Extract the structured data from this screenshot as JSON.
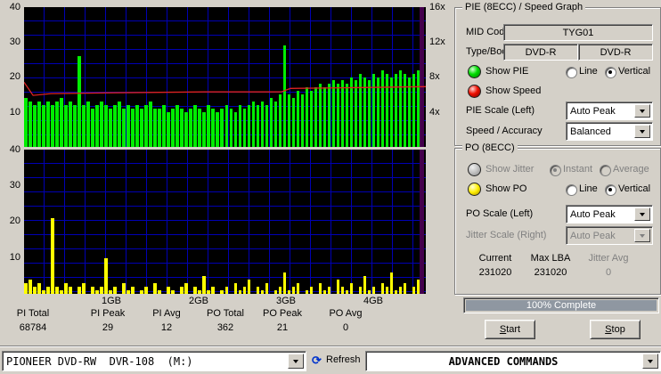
{
  "graphs": {
    "x_ticks": [
      "1GB",
      "2GB",
      "3GB",
      "4GB"
    ],
    "pie": {
      "y_ticks": [
        "40",
        "30",
        "20",
        "10"
      ],
      "speed_ticks": [
        "16x",
        "12x",
        "8x",
        "4x"
      ],
      "bar_color": "#00ee00",
      "ymax": 40,
      "end_marker_color": "#44004c",
      "values": [
        14,
        13,
        12,
        13,
        12,
        13,
        12,
        13,
        14,
        12,
        13,
        12,
        26,
        12,
        13,
        11,
        12,
        13,
        12,
        11,
        12,
        13,
        11,
        12,
        11,
        12,
        11,
        12,
        13,
        11,
        11,
        12,
        10,
        11,
        12,
        11,
        10,
        11,
        12,
        11,
        10,
        12,
        11,
        10,
        11,
        12,
        11,
        10,
        12,
        11,
        12,
        13,
        12,
        13,
        12,
        14,
        13,
        15,
        29,
        15,
        14,
        16,
        15,
        17,
        16,
        17,
        18,
        17,
        18,
        19,
        18,
        19,
        18,
        20,
        19,
        21,
        20,
        19,
        21,
        20,
        22,
        21,
        20,
        21,
        22,
        21,
        20,
        21,
        22,
        21
      ],
      "speed_line": {
        "color": "#dd2222",
        "ymax": 16,
        "points": [
          [
            0,
            7.4
          ],
          [
            2,
            5.9
          ],
          [
            6,
            6.1
          ],
          [
            20,
            6.2
          ],
          [
            40,
            6.3
          ],
          [
            57,
            6.3
          ],
          [
            59,
            6.7
          ],
          [
            75,
            6.8
          ],
          [
            89,
            6.9
          ]
        ]
      }
    },
    "po": {
      "y_ticks": [
        "40",
        "30",
        "20",
        "10"
      ],
      "bar_color": "#ffff00",
      "ymax": 40,
      "end_marker_color": "#44004c",
      "values": [
        3,
        4,
        2,
        3,
        1,
        2,
        21,
        2,
        1,
        3,
        2,
        0,
        2,
        3,
        0,
        2,
        1,
        2,
        10,
        1,
        2,
        0,
        3,
        1,
        2,
        0,
        1,
        2,
        0,
        3,
        1,
        0,
        2,
        1,
        0,
        2,
        3,
        0,
        2,
        1,
        5,
        1,
        2,
        0,
        1,
        2,
        0,
        3,
        1,
        2,
        4,
        0,
        2,
        1,
        3,
        0,
        1,
        2,
        6,
        1,
        2,
        3,
        0,
        1,
        2,
        0,
        3,
        1,
        2,
        0,
        4,
        2,
        1,
        3,
        0,
        2,
        5,
        1,
        2,
        0,
        3,
        2,
        6,
        1,
        2,
        3,
        0,
        2,
        4,
        1
      ]
    }
  },
  "stats": {
    "items": [
      {
        "label": "PI Total",
        "value": "68784"
      },
      {
        "label": "PI Peak",
        "value": "29"
      },
      {
        "label": "PI Avg",
        "value": "12"
      },
      {
        "label": "PO Total",
        "value": "362"
      },
      {
        "label": "PO Peak",
        "value": "21"
      },
      {
        "label": "PO Avg",
        "value": "0"
      }
    ]
  },
  "pie_panel": {
    "title": "PIE (8ECC) / Speed Graph",
    "mid_code_label": "MID Code",
    "mid_code_value": "TYG01",
    "type_book_label": "Type/Book",
    "type_value": "DVD-R",
    "book_value": "DVD-R",
    "show_pie_label": "Show PIE",
    "show_speed_label": "Show Speed",
    "line_label": "Line",
    "vertical_label": "Vertical",
    "pie_scale_label": "PIE Scale (Left)",
    "pie_scale_value": "Auto Peak",
    "speed_accuracy_label": "Speed / Accuracy",
    "speed_accuracy_value": "Balanced"
  },
  "po_panel": {
    "title": "PO (8ECC)",
    "show_jitter_label": "Show Jitter",
    "instant_label": "Instant",
    "average_label": "Average",
    "show_po_label": "Show PO",
    "line_label": "Line",
    "vertical_label": "Vertical",
    "po_scale_label": "PO Scale (Left)",
    "po_scale_value": "Auto Peak",
    "jitter_scale_label": "Jitter Scale (Right)",
    "jitter_scale_value": "Auto Peak",
    "current_label": "Current",
    "current_value": "231020",
    "max_lba_label": "Max LBA",
    "max_lba_value": "231020",
    "jitter_avg_label": "Jitter Avg",
    "jitter_avg_value": "0"
  },
  "progress": {
    "label": "100% Complete",
    "fill_color": "#8f97a1"
  },
  "actions": {
    "start_key": "S",
    "start_rest": "tart",
    "stop_key": "S",
    "stop_rest": "top"
  },
  "drive_bar": {
    "drive": "PIONEER DVD-RW  DVR-108  (M:)",
    "refresh": "Refresh",
    "commands": "ADVANCED COMMANDS"
  },
  "icons": {
    "refresh": "⟳"
  }
}
